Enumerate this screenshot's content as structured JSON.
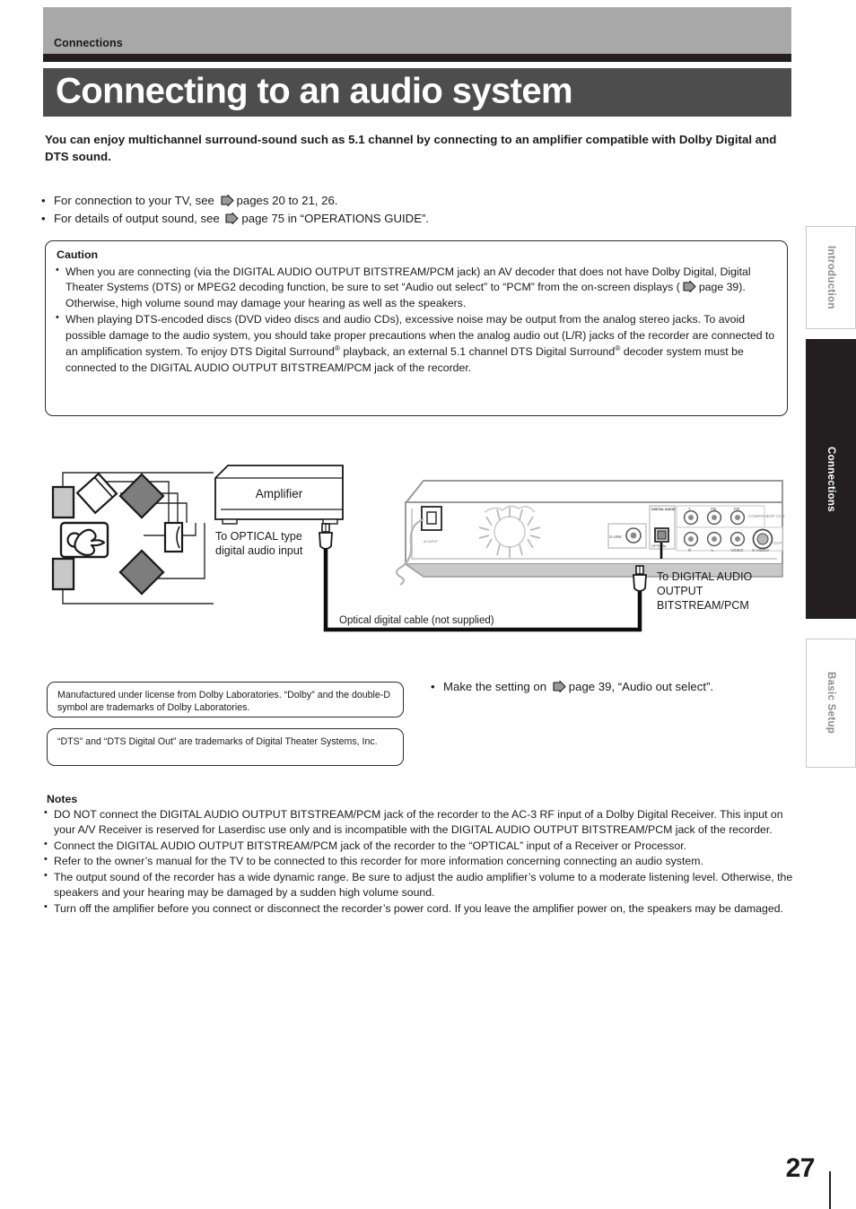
{
  "header": {
    "section_label": "Connections",
    "title": "Connecting to an audio system"
  },
  "intro": {
    "lead": "You can enjoy multichannel surround-sound such as 5.1 channel by connecting to an amplifier compatible with Dolby Digital and DTS sound.",
    "see_also": [
      {
        "pre": "For connection to your TV, see",
        "post": "pages 20 to 21, 26."
      },
      {
        "pre": "For details of output sound, see",
        "post": "page 75 in “OPERATIONS GUIDE”."
      }
    ]
  },
  "caution": {
    "title": "Caution",
    "items": [
      {
        "part1": "When you are connecting (via the DIGITAL AUDIO OUTPUT BITSTREAM/PCM jack) an AV decoder that does not have Dolby Digital, Digital Theater Systems (DTS) or MPEG2 decoding function, be sure to set “Audio out select” to “PCM” from the on-screen displays (",
        "part2": "page 39). Otherwise, high volume sound may damage your hearing as well as the speakers."
      },
      {
        "part1": "When playing DTS-encoded discs (DVD video discs and audio CDs), excessive noise may be output from the analog stereo jacks.  To avoid possible damage to the audio system, you should take proper precautions when the analog audio out (L/R) jacks of the recorder are connected to an amplification system.  To enjoy DTS Digital Surround",
        "part2": " playback, an external 5.1 channel DTS Digital Surround",
        "part3": " decoder system must be connected to the DIGITAL AUDIO OUTPUT BITSTREAM/PCM jack of the recorder."
      }
    ]
  },
  "diagram": {
    "amplifier_label": "Amplifier",
    "optical_input_label_line1": "To OPTICAL type",
    "optical_input_label_line2": "digital audio input",
    "cable_label": "Optical digital cable (not supplied)",
    "recorder_jack_label_line1": "To DIGITAL AUDIO",
    "recorder_jack_label_line2": "OUTPUT",
    "recorder_jack_label_line3": "BITSTREAM/PCM",
    "rear_panel": {
      "ac_in": "AC IN PUT",
      "g_link": "G-LINK",
      "optical": "OPTICAL",
      "digital_audio_out": "DIGITAL AUDIO OUTPUT BITSTREAM/PCM",
      "component_out": "COMPONENT OUT",
      "jack_y": "Y",
      "jack_pb": "PB",
      "jack_pr": "PR",
      "jack_r": "R",
      "jack_l": "L",
      "jack_video": "VIDEO",
      "jack_svideo": "S-VIDEO",
      "out_label": "OUT"
    }
  },
  "trademarks": {
    "dolby": "Manufactured under license from Dolby Laboratories.  “Dolby” and the double-D symbol are trademarks of Dolby Laboratories.",
    "dts": "“DTS” and “DTS Digital Out” are trademarks of Digital Theater Systems, Inc."
  },
  "setting_note": {
    "pre": "Make the setting on",
    "post": "page 39, “Audio out select”."
  },
  "notes": {
    "title": "Notes",
    "items": [
      "DO NOT connect the DIGITAL AUDIO OUTPUT BITSTREAM/PCM jack of the recorder to the AC-3 RF input of a Dolby Digital Receiver.  This input on your A/V Receiver is reserved for Laserdisc use only and is incompatible with the DIGITAL AUDIO OUTPUT BITSTREAM/PCM jack of the recorder.",
      "Connect the DIGITAL AUDIO OUTPUT BITSTREAM/PCM jack of the recorder to the “OPTICAL” input of a Receiver or Processor.",
      "Refer to the owner’s manual for the TV to be connected to this recorder for more information concerning connecting an audio system.",
      "The output sound of the recorder has a wide dynamic range. Be sure to adjust the audio amplifier’s volume to a moderate listening level. Otherwise, the speakers and your hearing may be damaged by a sudden high volume sound.",
      "Turn off the amplifier before you connect or disconnect the recorder’s power cord. If you leave the amplifier power on, the speakers may be damaged."
    ]
  },
  "side_tabs": [
    {
      "label": "Introduction",
      "active": false
    },
    {
      "label": "Connections",
      "active": true
    },
    {
      "label": "Basic Setup",
      "active": false
    }
  ],
  "page_number": "27",
  "colors": {
    "header_gray": "#a8a8a8",
    "header_black": "#231f20",
    "title_bar": "#4d4d4d",
    "tab_active_bg": "#231f20",
    "tab_inactive_text": "#8c8c8c"
  }
}
